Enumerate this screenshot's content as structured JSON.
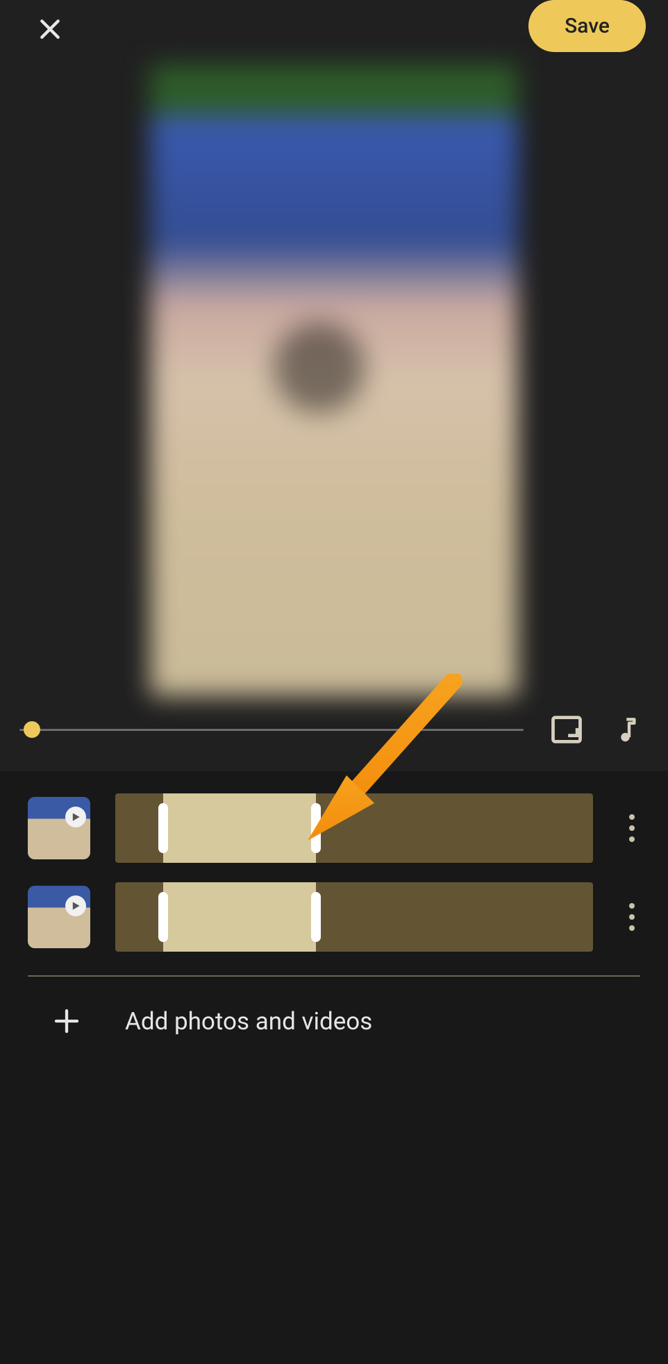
{
  "header": {
    "save_label": "Save",
    "close_icon": "close-icon"
  },
  "controls": {
    "aspect_icon": "aspect-ratio-icon",
    "music_icon": "music-note-icon",
    "scrubber_position_pct": 2
  },
  "clips": [
    {
      "thumb_kind": "video",
      "thumb_desc": "blurred outdoor video thumbnail with play badge",
      "selection_start_pct": 10,
      "selection_end_pct": 42
    },
    {
      "thumb_kind": "video",
      "thumb_desc": "blurred outdoor video thumbnail with play badge",
      "selection_start_pct": 10,
      "selection_end_pct": 42
    }
  ],
  "add_row": {
    "label": "Add photos and videos"
  },
  "annotation": {
    "kind": "arrow",
    "color": "#f59a1b",
    "target": "clip-1-handle-end",
    "note": "large orange arrow pointing at the right trim handle of the first clip"
  }
}
